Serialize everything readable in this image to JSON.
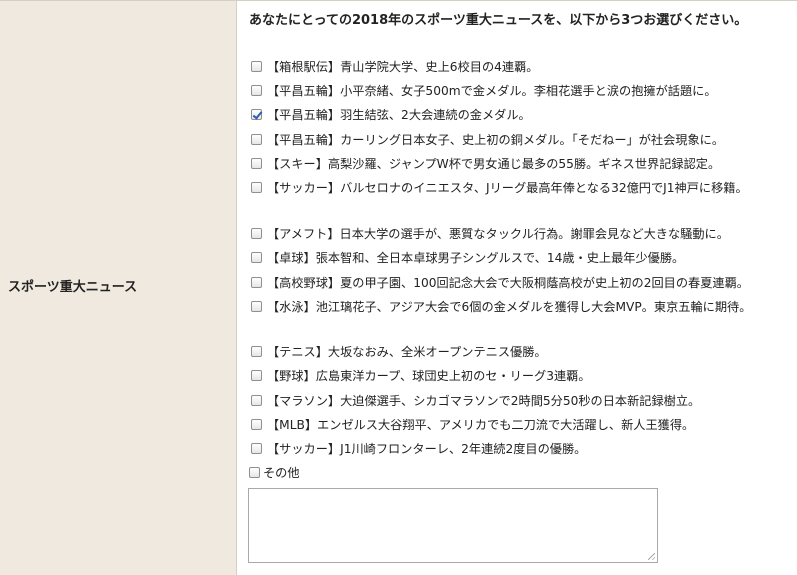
{
  "section": {
    "label": "スポーツ重大ニュース",
    "question": "あなたにとっての2018年のスポーツ重大ニュースを、以下から3つお選びください。"
  },
  "options": [
    {
      "text": "【箱根駅伝】青山学院大学、史上6校目の4連覇。",
      "checked": false
    },
    {
      "text": "【平昌五輪】小平奈緒、女子500mで金メダル。李相花選手と涙の抱擁が話題に。",
      "checked": false
    },
    {
      "text": "【平昌五輪】羽生結弦、2大会連続の金メダル。",
      "checked": true
    },
    {
      "text": "【平昌五輪】カーリング日本女子、史上初の銅メダル。「そだねー」が社会現象に。",
      "checked": false
    },
    {
      "text": "【スキー】高梨沙羅、ジャンプW杯で男女通じ最多の55勝。ギネス世界記録認定。",
      "checked": false
    },
    {
      "text": "【サッカー】バルセロナのイニエスタ、Jリーグ最高年俸となる32億円でJ1神戸に移籍。",
      "checked": false
    },
    {
      "text": "【アメフト】日本大学の選手が、悪質なタックル行為。謝罪会見など大きな騒動に。",
      "checked": false
    },
    {
      "text": "【卓球】張本智和、全日本卓球男子シングルスで、14歳・史上最年少優勝。",
      "checked": false
    },
    {
      "text": "【高校野球】夏の甲子園、100回記念大会で大阪桐蔭高校が史上初の2回目の春夏連覇。",
      "checked": false
    },
    {
      "text": "【水泳】池江璃花子、アジア大会で6個の金メダルを獲得し大会MVP。東京五輪に期待。",
      "checked": false
    },
    {
      "text": "【テニス】大坂なおみ、全米オープンテニス優勝。",
      "checked": false
    },
    {
      "text": "【野球】広島東洋カープ、球団史上初のセ・リーグ3連覇。",
      "checked": false
    },
    {
      "text": "【マラソン】大迫傑選手、シカゴマラソンで2時間5分50秒の日本新記録樹立。",
      "checked": false
    },
    {
      "text": "【MLB】エンゼルス大谷翔平、アメリカでも二刀流で大活躍し、新人王獲得。",
      "checked": false
    },
    {
      "text": "【サッカー】J1川崎フロンターレ、2年連続2度目の優勝。",
      "checked": false
    }
  ],
  "other": {
    "label": "その他",
    "checked": false,
    "value": ""
  }
}
